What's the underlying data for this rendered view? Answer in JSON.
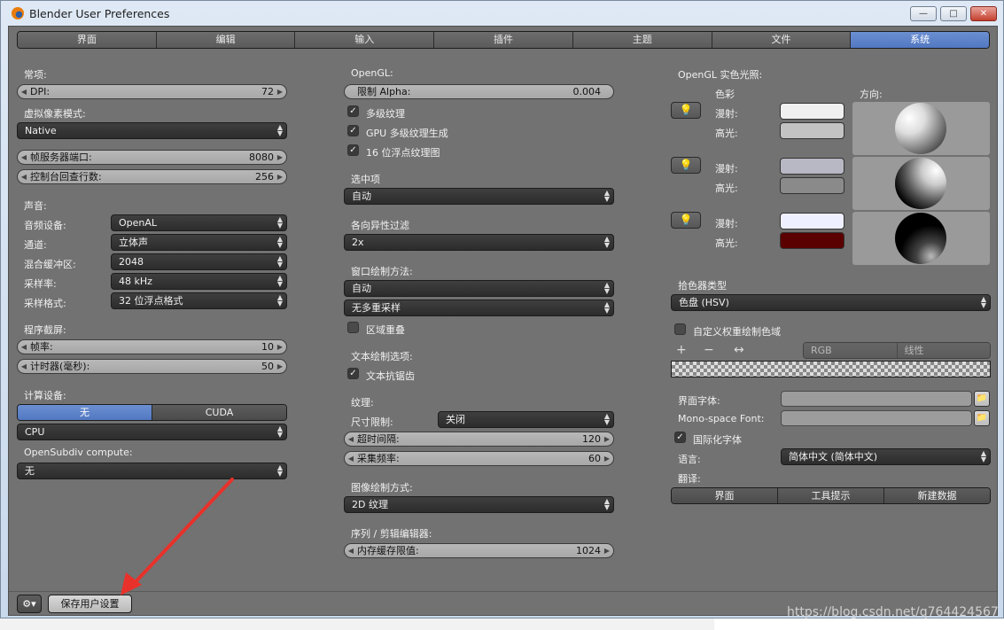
{
  "window": {
    "title": "Blender User Preferences",
    "min": "—",
    "max": "□",
    "close": "✕"
  },
  "tabs": [
    "界面",
    "编辑",
    "输入",
    "插件",
    "主题",
    "文件",
    "系统"
  ],
  "left": {
    "general_label": "常项:",
    "dpi": {
      "label": "DPI:",
      "value": "72"
    },
    "virtual_pixel_label": "虚拟像素模式:",
    "virtual_pixel_value": "Native",
    "frame_server": {
      "label": "帧服务器端口:",
      "value": "8080"
    },
    "console_lines": {
      "label": "控制台回查行数:",
      "value": "256"
    },
    "sound_label": "声音:",
    "audio_device": {
      "label": "音频设备:",
      "value": "OpenAL"
    },
    "channels": {
      "label": "通道:",
      "value": "立体声"
    },
    "mix_buffer": {
      "label": "混合缓冲区:",
      "value": "2048"
    },
    "sample_rate": {
      "label": "采样率:",
      "value": "48 kHz"
    },
    "sample_format": {
      "label": "采样格式:",
      "value": "32 位浮点格式"
    },
    "screencast_label": "程序截屏:",
    "fps": {
      "label": "帧率:",
      "value": "10"
    },
    "wait_timer": {
      "label": "计时器(毫秒):",
      "value": "50"
    },
    "compute_label": "计算设备:",
    "compute_options": [
      "无",
      "CUDA"
    ],
    "compute_device": "CPU",
    "opensubdiv_label": "OpenSubdiv compute:",
    "opensubdiv_value": "无"
  },
  "middle": {
    "opengl_label": "OpenGL:",
    "clip_alpha": {
      "label": "限制 Alpha:",
      "value": "0.004"
    },
    "mipmaps": "多级纹理",
    "gpu_mipmap": "GPU 多级纹理生成",
    "float_textures": "16 位浮点纹理图",
    "selection_label": "选中项",
    "selection_value": "自动",
    "anisotropic_label": "各向异性过滤",
    "anisotropic_value": "2x",
    "window_draw_label": "窗口绘制方法:",
    "window_draw_value": "自动",
    "multisample_value": "无多重采样",
    "region_overlap": "区域重叠",
    "text_draw_label": "文本绘制选项:",
    "text_antialias": "文本抗锯齿",
    "textures_label": "纹理:",
    "size_limit": {
      "label": "尺寸限制:",
      "value": "关闭"
    },
    "time_out": {
      "label": "超时间隔:",
      "value": "120"
    },
    "collection_rate": {
      "label": "采集频率:",
      "value": "60"
    },
    "image_draw_label": "图像绘制方式:",
    "image_draw_value": "2D 纹理",
    "sequencer_label": "序列 / 剪辑编辑器:",
    "memory_cache": {
      "label": "内存缓存限值:",
      "value": "1024"
    }
  },
  "right": {
    "solid_lights_label": "OpenGL 实色光照:",
    "colors_label": "色彩",
    "direction_label": "方向:",
    "lights": [
      {
        "diffuse_label": "漫射:",
        "specular_label": "高光:",
        "diffuse_color": "#efefef",
        "specular_color": "#c3c3c3"
      },
      {
        "diffuse_label": "漫射:",
        "specular_label": "高光:",
        "diffuse_color": "#b8b8c4",
        "specular_color": "#8a8a8a"
      },
      {
        "diffuse_label": "漫射:",
        "specular_label": "高光:",
        "diffuse_color": "#eef0ff",
        "specular_color": "#5a0000"
      }
    ],
    "light_icon": "lightbulb-icon",
    "color_picker_label": "拾色器类型",
    "color_picker_value": "色盘 (HSV)",
    "custom_weight": "自定义权重绘制色域",
    "ramp_add": "+",
    "ramp_remove": "−",
    "ramp_flip": "↔",
    "ramp_mode": "RGB",
    "ramp_interp": "线性",
    "interface_font_label": "界面字体:",
    "mono_font_label": "Mono-space Font:",
    "i18n_label": "国际化字体",
    "language_label": "语言:",
    "language_value": "简体中文 (简体中文)",
    "translate_label": "翻译:",
    "translate_options": [
      "界面",
      "工具提示",
      "新建数据"
    ]
  },
  "footer": {
    "save_label": "保存用户设置",
    "menu_icon": "preferences-menu-icon"
  },
  "watermark": "https://blog.csdn.net/q764424567"
}
